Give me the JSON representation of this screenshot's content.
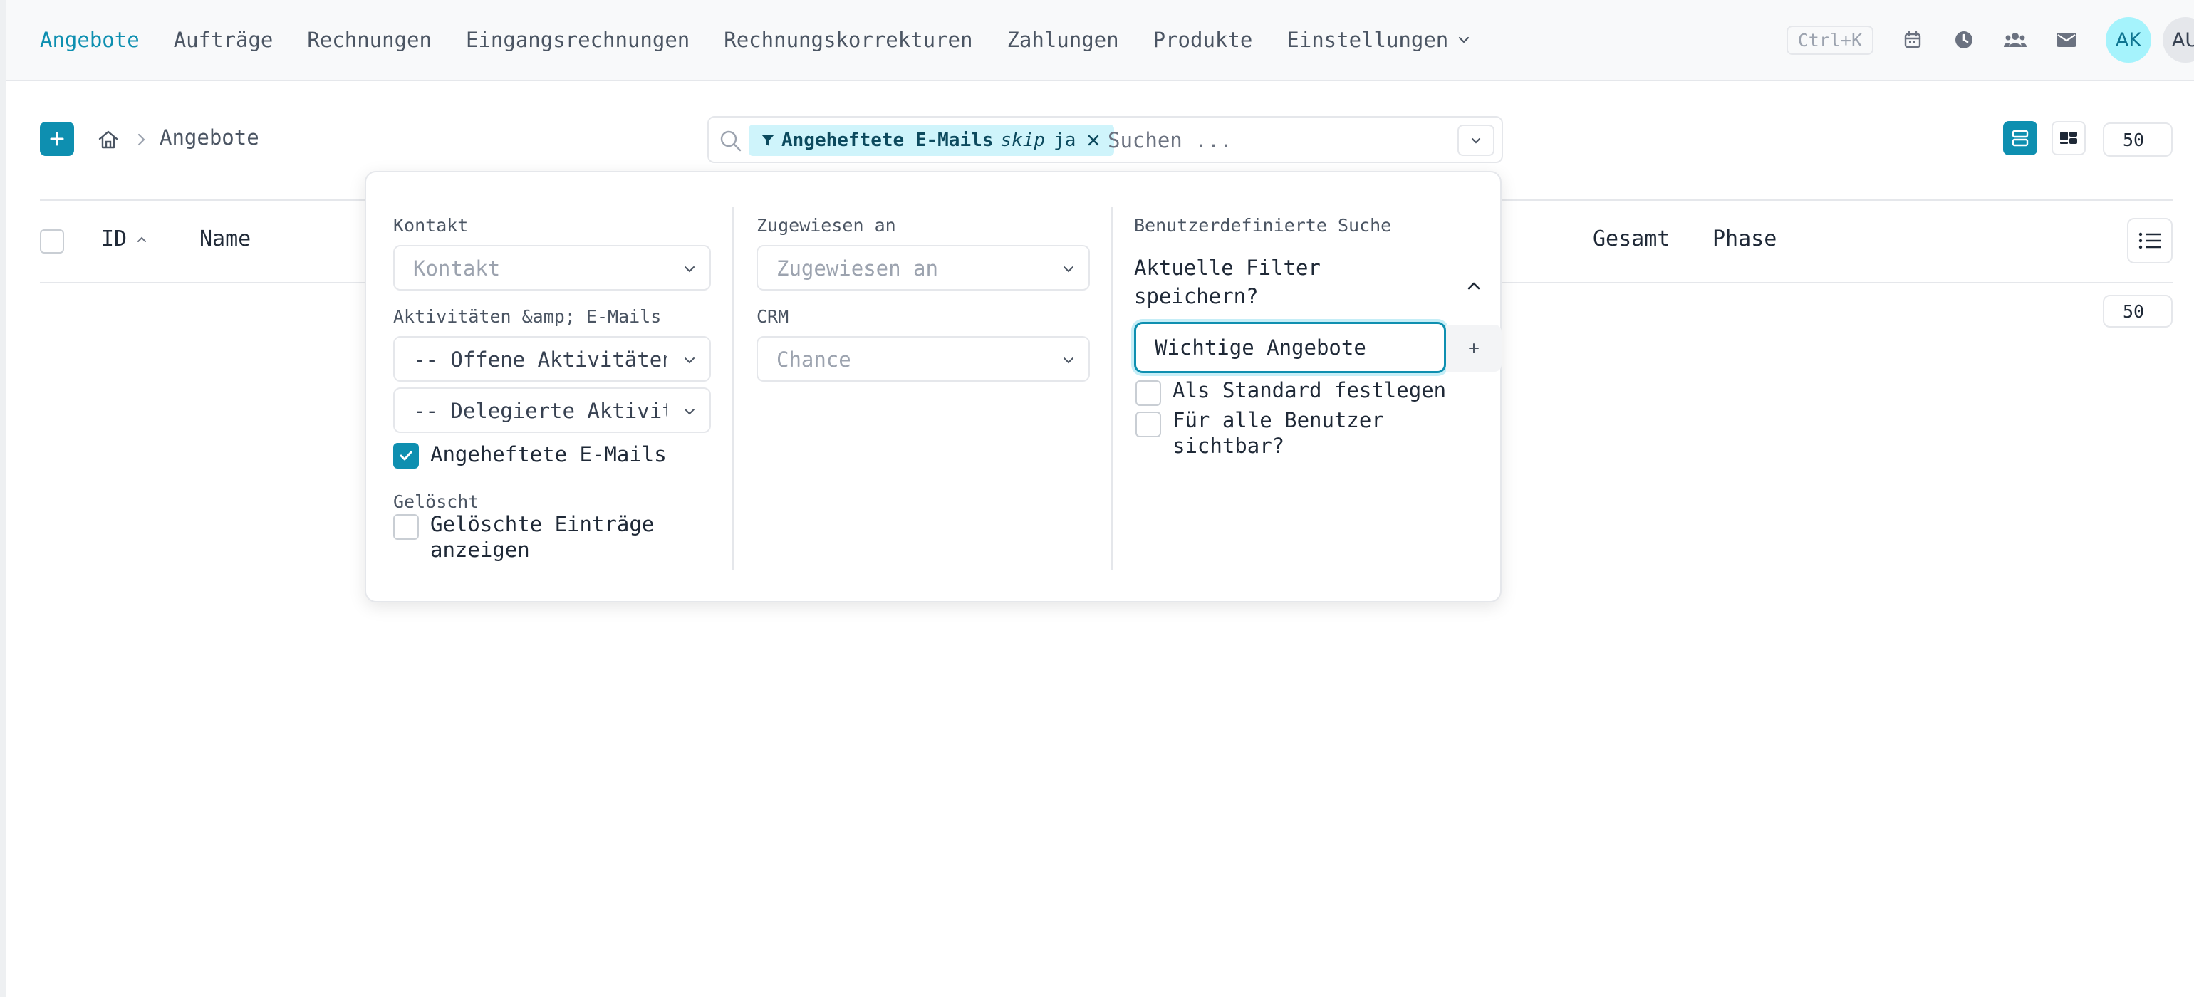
{
  "nav": {
    "items": [
      "Angebote",
      "Aufträge",
      "Rechnungen",
      "Eingangsrechnungen",
      "Rechnungskorrekturen",
      "Zahlungen",
      "Produkte"
    ],
    "settings": "Einstellungen",
    "shortcut": "Ctrl+K",
    "icons": [
      "calendar-icon",
      "clock-icon",
      "users-icon",
      "mail-icon"
    ],
    "avatars": [
      "AK",
      "AU"
    ]
  },
  "toolbar": {
    "breadcrumb": "Angebote",
    "per_page": "50"
  },
  "search": {
    "chip_label": "Angeheftete E-Mails",
    "chip_op": "skip",
    "chip_value": "ja",
    "placeholder": "Suchen ..."
  },
  "table": {
    "columns": {
      "id": "ID",
      "name": "Name",
      "total": "Gesamt",
      "phase": "Phase"
    },
    "per_page": "50"
  },
  "filter": {
    "contact_label": "Kontakt",
    "contact_placeholder": "Kontakt",
    "activities_label": "Aktivitäten &amp; E-Mails",
    "activities_open": "-- Offene Aktivitäten",
    "activities_delegated": "-- Delegierte Aktivitäten",
    "pinned_emails": "Angeheftete E-Mails",
    "deleted_label": "Gelöscht",
    "deleted_show_1": "Gelöschte Einträge",
    "deleted_show_2": "anzeigen",
    "assigned_label": "Zugewiesen an",
    "assigned_placeholder": "Zugewiesen an",
    "crm_label": "CRM",
    "crm_placeholder": "Chance",
    "custom_label": "Benutzerdefinierte Suche",
    "save_title_1": "Aktuelle Filter",
    "save_title_2": "speichern?",
    "save_input_value": "Wichtige Angebote",
    "as_default": "Als Standard festlegen",
    "visible_all_1": "Für alle Benutzer",
    "visible_all_2": "sichtbar?"
  },
  "colors": {
    "accent": "#0e8fb0",
    "chip_bg": "#cff4fb",
    "avatar_ak_bg": "#a5f3fc"
  }
}
